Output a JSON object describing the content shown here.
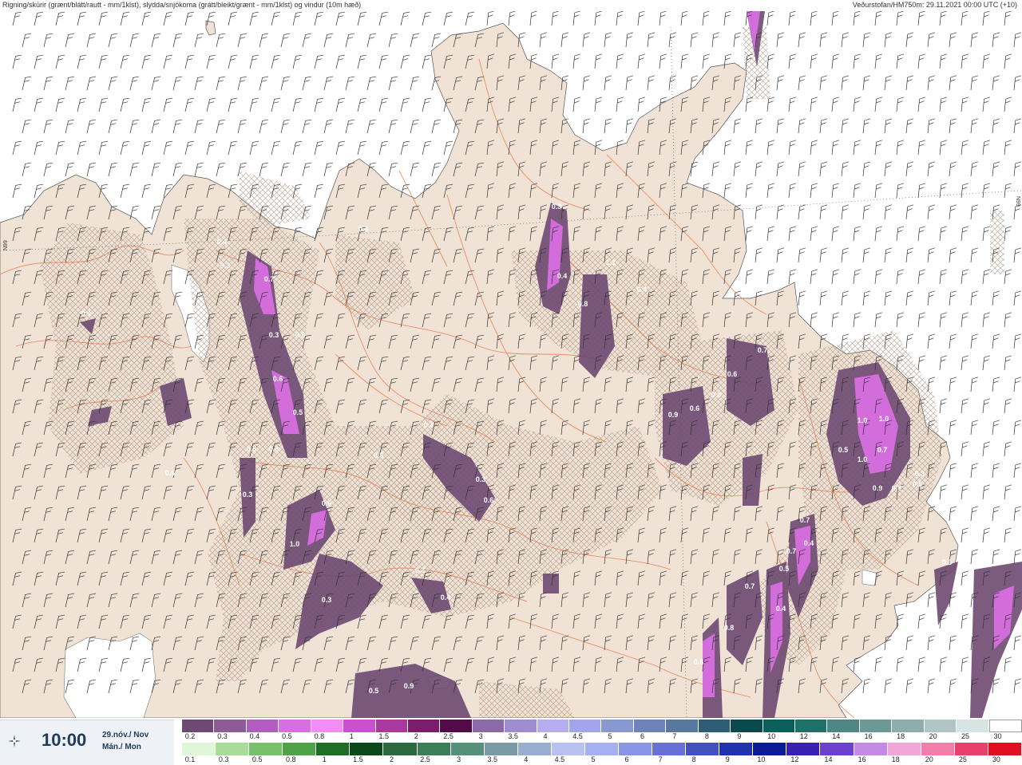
{
  "header": {
    "title_left": "Rigning/skúrir (grænt/blátt/rautt - mm/1klst), slydda/snjókoma (grátt/bleikt/grænt - mm/1klst) og vindur (10m hæð)",
    "title_right": "Veðurstofan/HM750m: 29.11.2021 00:00 UTC (+10)"
  },
  "map": {
    "land_color": "#f0e2d5",
    "sea_color": "#ffffff",
    "hatch_color": "#b49c8c",
    "road_color": "#e8733f",
    "graticule_label": "N99",
    "precip_labels": [
      "0.4",
      "0.3",
      "0.7",
      "0.3",
      "0.6",
      "0.5",
      "0.8",
      "0.4",
      "0.8",
      "0.6",
      "1.0",
      "0.3",
      "0.5",
      "0.4",
      "0.3",
      "0.6",
      "0.3",
      "0.4",
      "0.3",
      "0.4",
      "0.8",
      "1.1",
      "1.0",
      "1.0",
      "0.7",
      "0.5",
      "1.0",
      "0.9",
      "0.6",
      "0.9",
      "0.7",
      "0.6",
      "0.9",
      "0.7",
      "0.4",
      "0.3",
      "0.5",
      "0.9",
      "0.7",
      "0.6",
      "0.8",
      "0.7",
      "0.5",
      "0.4",
      "0.3",
      "0.8",
      "0.9",
      "0.4",
      "0.6",
      "0.5",
      "0.3",
      "0.4"
    ]
  },
  "time_panel": {
    "icon": "forecast-run-icon",
    "time": "10:00",
    "date_line1": "29.nóv./ Nov",
    "date_line2": "Mán./ Mon"
  },
  "legend": {
    "top": {
      "labels": [
        "0.2",
        "0.3",
        "0.4",
        "0.5",
        "0.8",
        "1",
        "1.5",
        "2",
        "2.5",
        "3",
        "3.5",
        "4",
        "4.5",
        "5",
        "6",
        "7",
        "8",
        "9",
        "10",
        "12",
        "14",
        "16",
        "18",
        "20",
        "25",
        "30"
      ],
      "colors": [
        "#6e4a72",
        "#8e5a98",
        "#b15dbd",
        "#d76fe0",
        "#f08ef4",
        "#cc4fce",
        "#a83a9e",
        "#7a1d6d",
        "#520a48",
        "#8a6aa8",
        "#a08ad0",
        "#b6aef0",
        "#a2a6e8",
        "#8898d0",
        "#6e84b8",
        "#5878a0",
        "#2e5e76",
        "#0a4a4e",
        "#0b5e5a",
        "#1e7068",
        "#4e8684",
        "#6c9896",
        "#8eaeae",
        "#b0c6c6",
        "#d8e4e4",
        "#ffffff"
      ]
    },
    "bottom": {
      "labels": [
        "0.1",
        "0.3",
        "0.5",
        "0.8",
        "1",
        "1.5",
        "2",
        "2.5",
        "3",
        "3.5",
        "4",
        "4.5",
        "5",
        "6",
        "7",
        "8",
        "9",
        "10",
        "12",
        "14",
        "16",
        "18",
        "20",
        "25",
        "30"
      ],
      "colors": [
        "#dff7d8",
        "#a8dc98",
        "#78c06c",
        "#4ea248",
        "#1e6e28",
        "#0a4a1a",
        "#2a6a3e",
        "#3c7e55",
        "#55907a",
        "#7c9aa6",
        "#98aed0",
        "#b8c2f2",
        "#a6aef4",
        "#8a94e8",
        "#6870d6",
        "#4450c0",
        "#2232ae",
        "#0c1a98",
        "#3820b0",
        "#6a40cc",
        "#c48ae6",
        "#f2a6d8",
        "#f07ea8",
        "#e8406a",
        "#e01020"
      ]
    }
  }
}
